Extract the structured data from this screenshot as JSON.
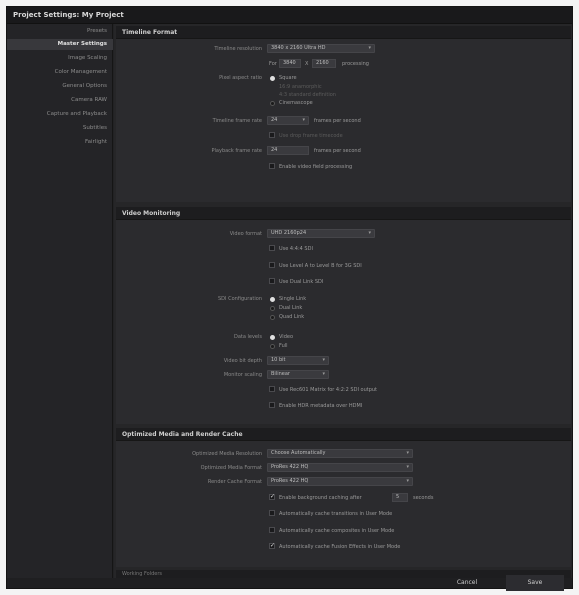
{
  "window": {
    "title": "Project Settings: My Project"
  },
  "sidebar": {
    "items": [
      {
        "label": "Presets"
      },
      {
        "label": "Master Settings"
      },
      {
        "label": "Image Scaling"
      },
      {
        "label": "Color Management"
      },
      {
        "label": "General Options"
      },
      {
        "label": "Camera RAW"
      },
      {
        "label": "Capture and Playback"
      },
      {
        "label": "Subtitles"
      },
      {
        "label": "Fairlight"
      }
    ]
  },
  "timeline_format": {
    "title": "Timeline Format",
    "resolution_label": "Timeline resolution",
    "resolution_value": "3840 x 2160 Ultra HD",
    "for_label": "For",
    "width": "3840",
    "x_label": "X",
    "height": "2160",
    "processing_label": "processing",
    "pixel_aspect_label": "Pixel aspect ratio",
    "aspect_options": [
      "Square",
      "16:9 anamorphic",
      "4:3 standard definition",
      "Cinemascope"
    ],
    "frame_rate_label": "Timeline frame rate",
    "frame_rate_value": "24",
    "frame_rate_unit": "frames per second",
    "drop_frame_label": "Use drop frame timecode",
    "playback_rate_label": "Playback frame rate",
    "playback_rate_value": "24",
    "playback_rate_unit": "frames per second",
    "video_field_label": "Enable video field processing"
  },
  "video_monitoring": {
    "title": "Video Monitoring",
    "format_label": "Video format",
    "format_value": "UHD 2160p24",
    "checks": [
      "Use 4:4:4 SDI",
      "Use Level A to Level B for 3G SDI",
      "Use Dual Link SDI"
    ],
    "sdi_label": "SDI Configuration",
    "sdi_options": [
      "Single Link",
      "Dual Link",
      "Quad Link"
    ],
    "data_levels_label": "Data levels",
    "data_levels_options": [
      "Video",
      "Full"
    ],
    "bit_depth_label": "Video bit depth",
    "bit_depth_value": "10 bit",
    "monitor_scaling_label": "Monitor scaling",
    "monitor_scaling_value": "Bilinear",
    "extra_checks": [
      "Use Rec601 Matrix for 4:2:2 SDI output",
      "Enable HDR metadata over HDMI"
    ]
  },
  "optimized_media": {
    "title": "Optimized Media and Render Cache",
    "resolution_label": "Optimized Media Resolution",
    "resolution_value": "Choose Automatically",
    "format_label": "Optimized Media Format",
    "format_value": "ProRes 422 HQ",
    "cache_format_label": "Render Cache Format",
    "cache_format_value": "ProRes 422 HQ",
    "bg_cache_label": "Enable background caching after",
    "bg_cache_value": "5",
    "bg_cache_unit": "seconds",
    "auto_cache_1": "Automatically cache transitions in User Mode",
    "auto_cache_2": "Automatically cache composites in User Mode",
    "auto_cache_3": "Automatically cache Fusion Effects in User Mode"
  },
  "next_section": "Working Folders",
  "footer": {
    "cancel_label": "Cancel",
    "save_label": "Save"
  }
}
